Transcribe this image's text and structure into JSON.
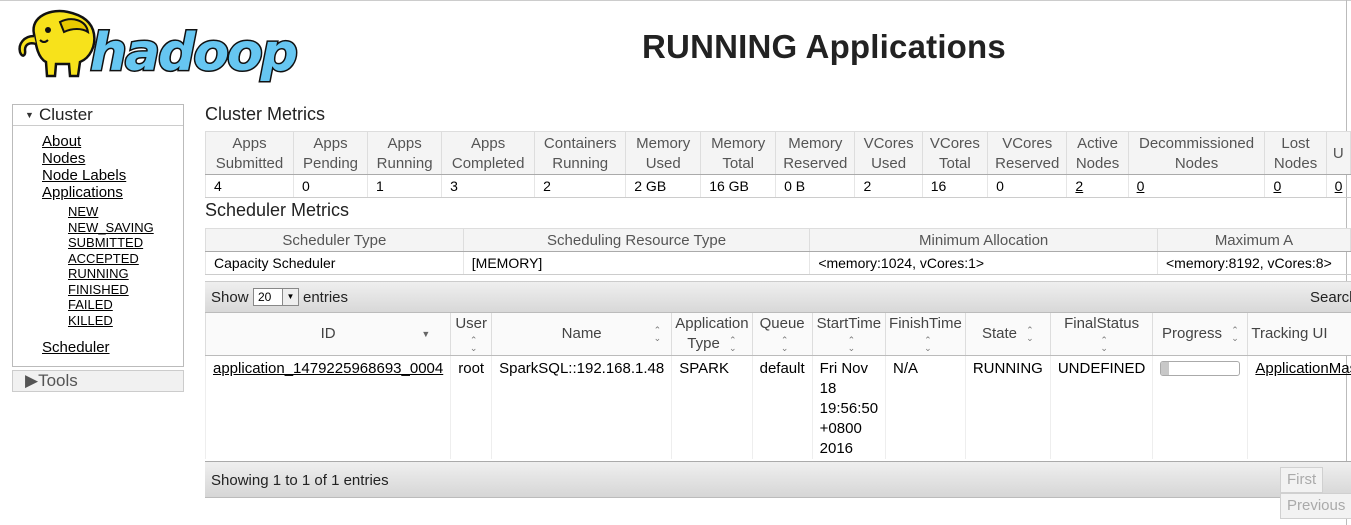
{
  "header": {
    "logo_text": "hadoop",
    "title": "RUNNING Applications"
  },
  "sidebar": {
    "cluster_label": "Cluster",
    "links": [
      "About",
      "Nodes",
      "Node Labels",
      "Applications"
    ],
    "app_states": [
      "NEW",
      "NEW_SAVING",
      "SUBMITTED",
      "ACCEPTED",
      "RUNNING",
      "FINISHED",
      "FAILED",
      "KILLED"
    ],
    "scheduler_label": "Scheduler",
    "tools_label": "Tools"
  },
  "cluster_metrics": {
    "title": "Cluster Metrics",
    "columns": [
      {
        "label": "Apps Submitted",
        "value": "4"
      },
      {
        "label": "Apps Pending",
        "value": "0"
      },
      {
        "label": "Apps Running",
        "value": "1"
      },
      {
        "label": "Apps Completed",
        "value": "3"
      },
      {
        "label": "Containers Running",
        "value": "2"
      },
      {
        "label": "Memory Used",
        "value": "2 GB"
      },
      {
        "label": "Memory Total",
        "value": "16 GB"
      },
      {
        "label": "Memory Reserved",
        "value": "0 B"
      },
      {
        "label": "VCores Used",
        "value": "2"
      },
      {
        "label": "VCores Total",
        "value": "16"
      },
      {
        "label": "VCores Reserved",
        "value": "0"
      },
      {
        "label": "Active Nodes",
        "value": "2"
      },
      {
        "label": "Decommissioned Nodes",
        "value": "0"
      },
      {
        "label": "Lost Nodes",
        "value": "0"
      },
      {
        "label": "U",
        "value": "0"
      }
    ]
  },
  "scheduler_metrics": {
    "title": "Scheduler Metrics",
    "columns": [
      {
        "label": "Scheduler Type",
        "value": "Capacity Scheduler"
      },
      {
        "label": "Scheduling Resource Type",
        "value": "[MEMORY]"
      },
      {
        "label": "Minimum Allocation",
        "value": "<memory:1024, vCores:1>"
      },
      {
        "label": "Maximum A",
        "value": "<memory:8192, vCores:8>"
      }
    ]
  },
  "apps": {
    "show_label": "Show",
    "entries_value": "20",
    "entries_label": "entries",
    "search_label": "Search:",
    "headers": [
      "ID",
      "User",
      "Name",
      "Application Type",
      "Queue",
      "StartTime",
      "FinishTime",
      "State",
      "FinalStatus",
      "Progress",
      "Tracking UI"
    ],
    "rows": [
      {
        "id": "application_1479225968693_0004",
        "user": "root",
        "name": "SparkSQL::192.168.1.48",
        "type": "SPARK",
        "queue": "default",
        "start_time": "Fri Nov 18 19:56:50 +0800 2016",
        "finish_time": "N/A",
        "state": "RUNNING",
        "final_status": "UNDEFINED",
        "progress_percent": 10,
        "tracking": "ApplicationMaster"
      }
    ],
    "info": "Showing 1 to 1 of 1 entries",
    "pager": [
      "First",
      "Previous"
    ]
  },
  "colors": {
    "logo_yellow": "#f7e21b",
    "logo_blue": "#66c6f1",
    "progress_fill": "#c8c8c8"
  }
}
